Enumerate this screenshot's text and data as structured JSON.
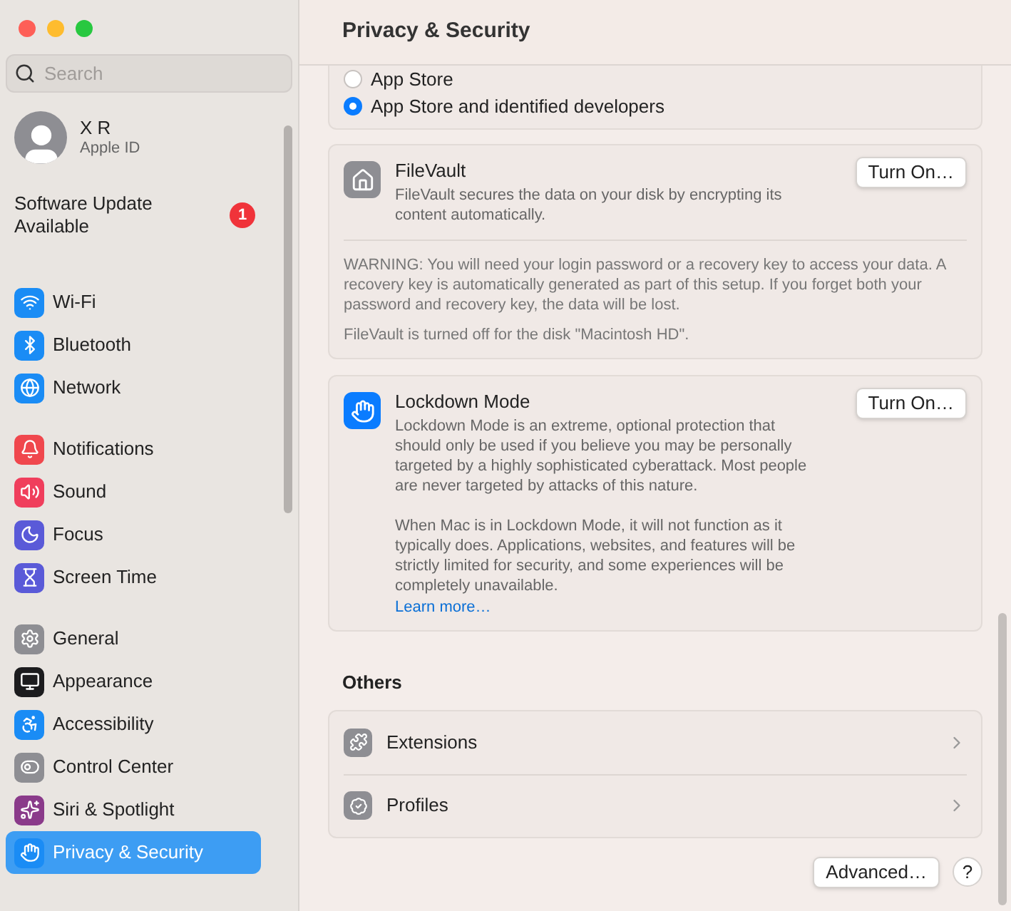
{
  "window": {
    "title": "Privacy & Security"
  },
  "sidebar": {
    "search": {
      "placeholder": "Search"
    },
    "account": {
      "name": "X R",
      "subtitle": "Apple ID"
    },
    "update": {
      "label": "Software Update Available",
      "badge": "1"
    },
    "groups": [
      {
        "items": [
          {
            "label": "Wi-Fi",
            "color": "#1a8cf5",
            "selected": false
          },
          {
            "label": "Bluetooth",
            "color": "#1a8cf5",
            "selected": false
          },
          {
            "label": "Network",
            "color": "#1a8cf5",
            "selected": false
          }
        ]
      },
      {
        "items": [
          {
            "label": "Notifications",
            "color": "#f0474d",
            "selected": false
          },
          {
            "label": "Sound",
            "color": "#f03e5c",
            "selected": false
          },
          {
            "label": "Focus",
            "color": "#5a5ad8",
            "selected": false
          },
          {
            "label": "Screen Time",
            "color": "#5a5ad8",
            "selected": false
          }
        ]
      },
      {
        "items": [
          {
            "label": "General",
            "color": "#8e8e93",
            "selected": false
          },
          {
            "label": "Appearance",
            "color": "#1c1c1e",
            "selected": false
          },
          {
            "label": "Accessibility",
            "color": "#1a8cf5",
            "selected": false
          },
          {
            "label": "Control Center",
            "color": "#8e8e93",
            "selected": false
          },
          {
            "label": "Siri & Spotlight",
            "color": "#8a3a8a",
            "selected": false
          },
          {
            "label": "Privacy & Security",
            "color": "#1a8cf5",
            "selected": true
          }
        ]
      }
    ]
  },
  "radio_options": [
    {
      "label": "App Store",
      "selected": false
    },
    {
      "label": "App Store and identified developers",
      "selected": true
    }
  ],
  "filevault": {
    "title": "FileVault",
    "description": "FileVault secures the data on your disk by encrypting its content automatically.",
    "button": "Turn On…",
    "warning": "WARNING: You will need your login password or a recovery key to access your data. A recovery key is automatically generated as part of this setup. If you forget both your password and recovery key, the data will be lost.",
    "status": "FileVault is turned off for the disk \"Macintosh HD\"."
  },
  "lockdown": {
    "title": "Lockdown Mode",
    "description": "Lockdown Mode is an extreme, optional protection that should only be used if you believe you may be personally targeted by a highly sophisticated cyberattack. Most people are never targeted by attacks of this nature.",
    "details": "When Mac is in Lockdown Mode, it will not function as it typically does. Applications, websites, and features will be strictly limited for security, and some experiences will be completely unavailable.",
    "link": "Learn more…",
    "button": "Turn On…"
  },
  "others": {
    "heading": "Others",
    "rows": [
      {
        "label": "Extensions"
      },
      {
        "label": "Profiles"
      }
    ]
  },
  "footer": {
    "advanced": "Advanced…",
    "help": "?"
  }
}
